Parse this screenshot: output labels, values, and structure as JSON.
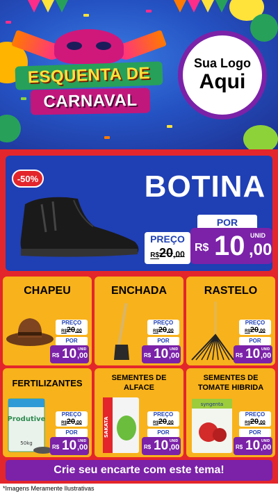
{
  "header": {
    "title_line1": "ESQUENTA DE",
    "title_line2": "CARNAVAL",
    "logo_line1": "Sua Logo",
    "logo_line2": "Aqui"
  },
  "featured": {
    "discount": "-50%",
    "name": "BOTINA",
    "por_label": "POR",
    "preco_label": "PREÇO",
    "old_price_int": "20",
    "old_price_cents": ",00",
    "old_price_prefix": "R$",
    "currency": "R$",
    "unit": "UNID",
    "new_price_int": "10",
    "new_price_cents": ",00",
    "image_icon": "boot-icon"
  },
  "products": [
    {
      "name": "CHAPEU",
      "preco_label": "PREÇO",
      "old_prefix": "R$",
      "old_int": "20",
      "old_cents": ",00",
      "por_label": "POR",
      "currency": "R$",
      "price_int": "10",
      "price_cents": ",00",
      "unit": "UNID",
      "icon": "hat-icon"
    },
    {
      "name": "ENCHADA",
      "preco_label": "PREÇO",
      "old_prefix": "R$",
      "old_int": "20",
      "old_cents": ",00",
      "por_label": "POR",
      "currency": "R$",
      "price_int": "10",
      "price_cents": ",00",
      "unit": "UNID",
      "icon": "hoe-icon"
    },
    {
      "name": "RASTELO",
      "preco_label": "PREÇO",
      "old_prefix": "R$",
      "old_int": "20",
      "old_cents": ",00",
      "por_label": "POR",
      "currency": "R$",
      "price_int": "10",
      "price_cents": ",00",
      "unit": "UNID",
      "icon": "rake-icon"
    },
    {
      "name": "FERTILIZANTES",
      "preco_label": "PREÇO",
      "old_prefix": "R$",
      "old_int": "20",
      "old_cents": ",00",
      "por_label": "POR",
      "currency": "R$",
      "price_int": "10",
      "price_cents": ",00",
      "unit": "UNID",
      "icon": "fertilizer-bag-icon",
      "bag_text": "Produtive",
      "bag_weight": "50kg"
    },
    {
      "name_line1": "SEMENTES DE",
      "name_line2": "ALFACE",
      "preco_label": "PREÇO",
      "old_prefix": "R$",
      "old_int": "20",
      "old_cents": ",00",
      "por_label": "POR",
      "currency": "R$",
      "price_int": "10",
      "price_cents": ",00",
      "unit": "UNID",
      "icon": "seed-packet-icon",
      "packet_brand": "SAKATA"
    },
    {
      "name_line1": "SEMENTES DE",
      "name_line2": "TOMATE HIBRIDA",
      "preco_label": "PREÇO",
      "old_prefix": "R$",
      "old_int": "20",
      "old_cents": ",00",
      "por_label": "POR",
      "currency": "R$",
      "price_int": "10",
      "price_cents": ",00",
      "unit": "UNID",
      "icon": "tomato-seed-packet-icon",
      "packet_brand": "syngenta"
    }
  ],
  "footer": {
    "cta": "Crie seu encarte com este tema!",
    "disclaimer": "*Imagens Meramente Ilustrativas"
  },
  "colors": {
    "header_blue": "#2553c4",
    "flyer_red": "#e3262b",
    "featured_blue": "#1f3fb4",
    "card_yellow": "#f8b21b",
    "price_purple": "#7b22a8"
  }
}
